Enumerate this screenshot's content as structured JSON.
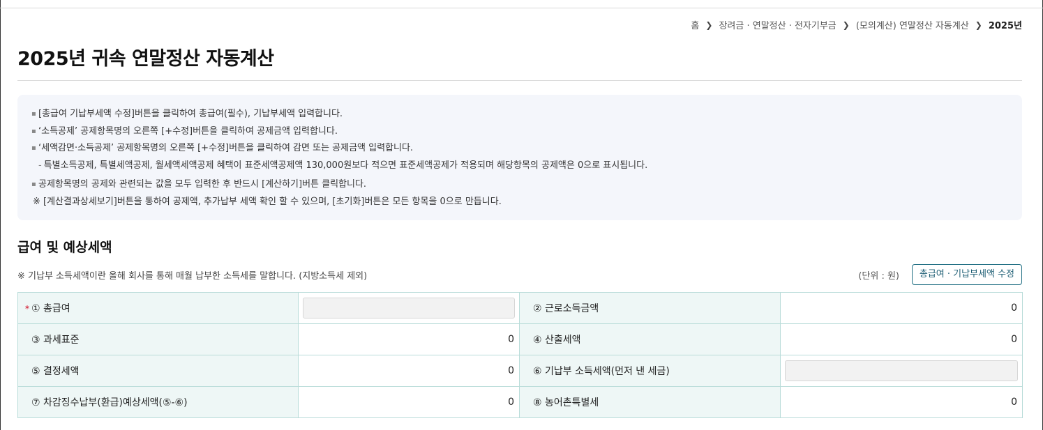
{
  "breadcrumb": [
    "홈",
    "장려금 · 연말정산 · 전자기부금",
    "(모의계산) 연말정산 자동계산",
    "2025년"
  ],
  "page_title": "2025년 귀속 연말정산 자동계산",
  "notice": {
    "lines": [
      "[총급여 기납부세액 수정]버튼을 클릭하여 총급여(필수), 기납부세액 입력합니다.",
      "‘소득공제’ 공제항목명의 오른쪽 [+수정]버튼을 클릭하여 공제금액 입력합니다.",
      "‘세액감면·소득공제’ 공제항목명의 오른쪽 [+수정]버튼을 클릭하여 감면 또는 공제금액 입력합니다."
    ],
    "sub_line": "특별소득공제, 특별세액공제, 월세액세액공제 혜택이 표준세액공제액 130,000원보다 적으면 표준세액공제가 적용되며 해당항목의 공제액은 0으로 표시됩니다.",
    "line4": "공제항목명의 공제와 관련되는 값을 모두 입력한 후 반드시 [계산하기]버튼 클릭합니다.",
    "line5": "※ [계산결과상세보기]버튼을 통하여 공제액, 추가납부 세액 확인 할 수 있으며, [초기화]버튼은 모든 항목을 0으로 만듭니다."
  },
  "section": {
    "title": "급여 및 예상세액",
    "note": "※ 기납부 소득세액이란 올해 회사를 통해 매월 납부한 소득세를 말합니다. (지방소득세 제외)",
    "unit": "(단위 : 원)",
    "edit_button": "총급여 · 기납부세액 수정"
  },
  "table": {
    "required_mark": "*",
    "r1": {
      "l1": "① 총급여",
      "v1": "",
      "l2": "② 근로소득금액",
      "v2": "0"
    },
    "r2": {
      "l1": "③ 과세표준",
      "v1": "0",
      "l2": "④ 산출세액",
      "v2": "0"
    },
    "r3": {
      "l1": "⑤ 결정세액",
      "v1": "0",
      "l2": "⑥ 기납부 소득세액(먼저 낸 세금)",
      "v2": ""
    },
    "r4": {
      "l1": "⑦ 차감징수납부(환급)예상세액(⑤-⑥)",
      "v1": "0",
      "l2": "⑧ 농어촌특별세",
      "v2": "0"
    }
  }
}
